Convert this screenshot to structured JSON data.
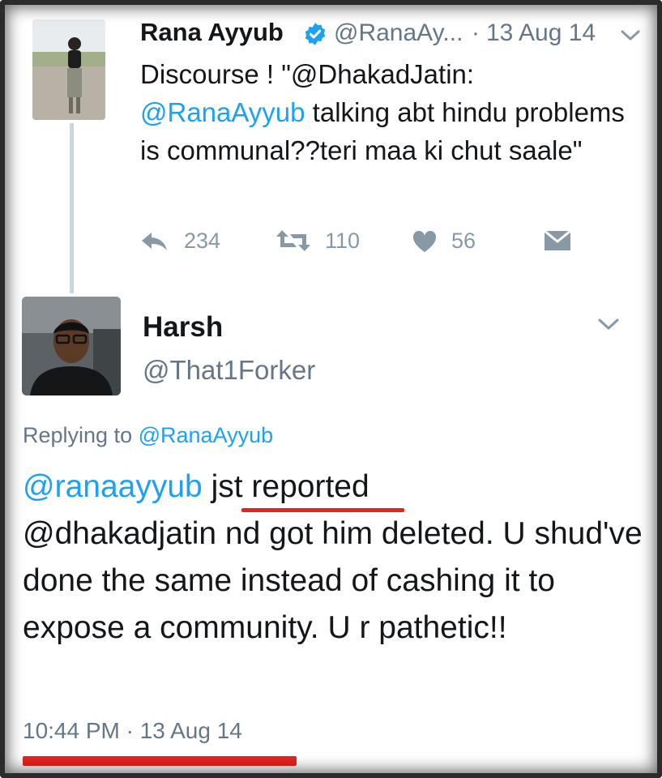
{
  "original_tweet": {
    "author_name": "Rana Ayyub",
    "author_handle": "@RanaAy...",
    "separator": "·",
    "date": "13 Aug 14",
    "text_line1": "Discourse ! \"@DhakadJatin:",
    "mention": "@RanaAyyub",
    "text_rest": " talking abt hindu problems is communal??teri maa ki chut saale\"",
    "reply_count": "234",
    "retweet_count": "110",
    "like_count": "56"
  },
  "reply_tweet": {
    "author_name": "Harsh",
    "author_handle": "@That1Forker",
    "replying_to_label": "Replying to",
    "replying_to_handle": "@RanaAyyub",
    "mention": "@ranaayyub",
    "text_highlight": "jst reported",
    "text_rest": "@dhakadjatin nd got him deleted. U shud've done the same instead of cashing it to expose a community. U r pathetic!!",
    "timestamp": "10:44 PM · 13 Aug 14"
  },
  "icons": [
    "verified-badge-icon",
    "chevron-down-icon",
    "reply-icon",
    "retweet-icon",
    "heart-icon",
    "direct-message-icon"
  ],
  "colors": {
    "link": "#1da1f2",
    "muted": "#657786",
    "annotation": "#e8231d",
    "verified": "#1da1f2"
  }
}
